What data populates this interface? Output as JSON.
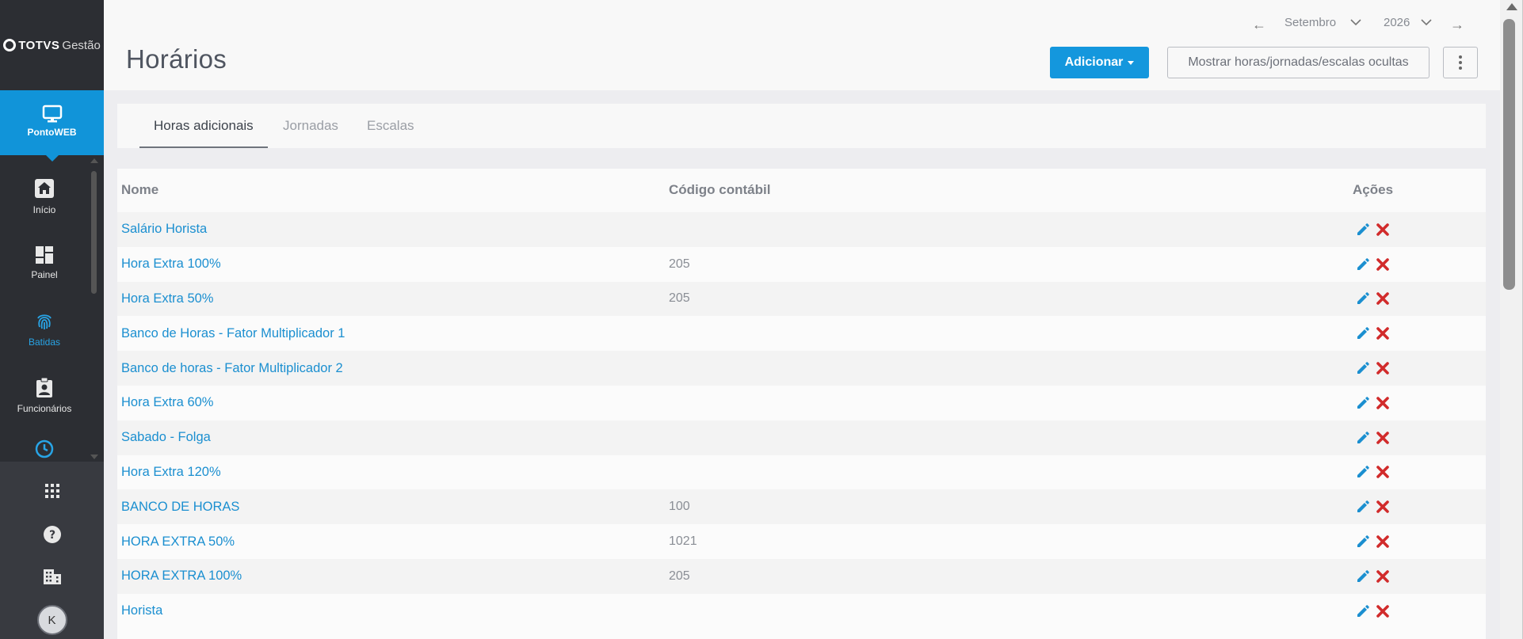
{
  "brand": {
    "logo_text": "TOTVS",
    "logo_sub": "Gestão"
  },
  "module": {
    "label": "PontoWEB",
    "icon": "monitor-icon"
  },
  "sidebar": {
    "items": [
      {
        "label": "Início",
        "icon": "home-icon",
        "active": false
      },
      {
        "label": "Painel",
        "icon": "dashboard-icon",
        "active": false
      },
      {
        "label": "Batidas",
        "icon": "fingerprint-icon",
        "active": true
      },
      {
        "label": "Funcionários",
        "icon": "badge-icon",
        "active": false
      }
    ],
    "bottom": [
      {
        "icon": "apps-grid-icon"
      },
      {
        "icon": "help-icon"
      },
      {
        "icon": "company-building-icon"
      },
      {
        "icon": "avatar",
        "initial": "K"
      }
    ]
  },
  "header": {
    "title": "Horários",
    "month": "Setembro",
    "year": "2026",
    "add_button": "Adicionar",
    "show_hidden_button": "Mostrar horas/jornadas/escalas ocultas"
  },
  "tabs": [
    {
      "label": "Horas adicionais",
      "active": true
    },
    {
      "label": "Jornadas",
      "active": false
    },
    {
      "label": "Escalas",
      "active": false
    }
  ],
  "table": {
    "columns": [
      "Nome",
      "Código contábil",
      "Ações"
    ],
    "rows": [
      {
        "name": "Salário Horista",
        "code": ""
      },
      {
        "name": "Hora Extra 100%",
        "code": "205"
      },
      {
        "name": "Hora Extra 50%",
        "code": "205"
      },
      {
        "name": "Banco de Horas - Fator Multiplicador 1",
        "code": ""
      },
      {
        "name": "Banco de horas - Fator Multiplicador 2",
        "code": ""
      },
      {
        "name": "Hora Extra 60%",
        "code": ""
      },
      {
        "name": "Sabado - Folga",
        "code": ""
      },
      {
        "name": "Hora Extra 120%",
        "code": ""
      },
      {
        "name": "BANCO DE HORAS",
        "code": "100"
      },
      {
        "name": "HORA EXTRA 50%",
        "code": "1021"
      },
      {
        "name": "HORA EXTRA 100%",
        "code": "205"
      },
      {
        "name": "Horista",
        "code": ""
      }
    ]
  },
  "colors": {
    "accent": "#1497dd",
    "sidebar_bg": "#2c2e33",
    "link": "#1b8fd0",
    "delete": "#d12b2b"
  }
}
